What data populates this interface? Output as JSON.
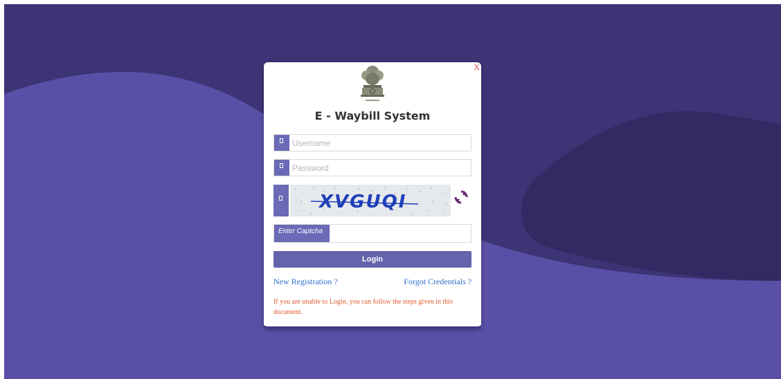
{
  "colors": {
    "bg_light": "#5a4fa6",
    "bg_dark": "#3d3476",
    "bg_darker": "#332a63",
    "accent": "#6a6ab6",
    "link": "#2a6fc9",
    "notice": "#e0582a",
    "close": "#d24a4a"
  },
  "login": {
    "close_label": "X",
    "emblem_icon": "india-emblem-icon",
    "title": "E - Waybill System",
    "username_placeholder": "Username",
    "password_placeholder": "Password",
    "captcha_text": "XVGUQI",
    "refresh_icon": "refresh-icon",
    "enter_captcha_label": "Enter Captcha",
    "login_button": "Login",
    "new_registration": "New Registration ?",
    "forgot_credentials": "Forgot Credentials ?",
    "help_text": "If you are unable to Login, you can follow the steps given in this document."
  }
}
